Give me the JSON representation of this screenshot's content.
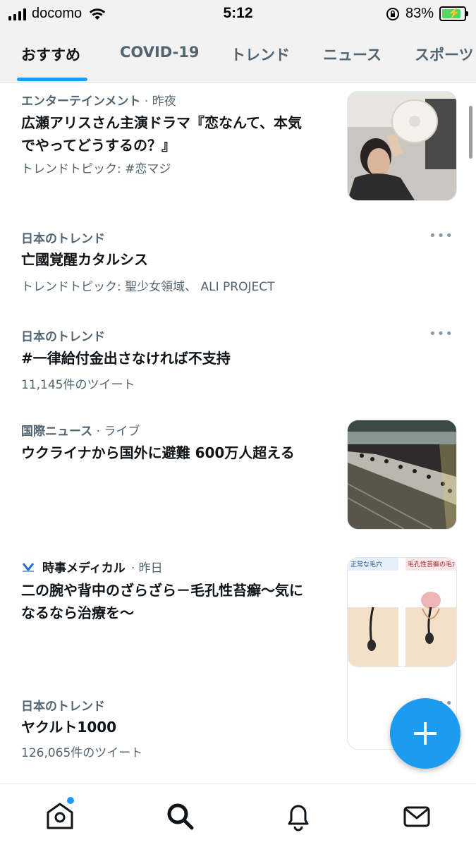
{
  "status_bar": {
    "carrier": "docomo",
    "time": "5:12",
    "battery_percent": "83%"
  },
  "tabs": [
    {
      "label": "おすすめ",
      "active": true
    },
    {
      "label": "COVID-19",
      "active": false
    },
    {
      "label": "トレンド",
      "active": false
    },
    {
      "label": "ニュース",
      "active": false
    },
    {
      "label": "スポーツ",
      "active": false
    }
  ],
  "feed": {
    "items": [
      {
        "category": "エンターテインメント",
        "time": "· 昨夜",
        "title_line1": "広瀬アリスさん主演ドラマ『恋なんて、本気",
        "title_line2": "でやってどうするの？』",
        "subtitle": "トレンドトピック: #恋マジ",
        "thumbnail": "drama-scene-photo"
      },
      {
        "category": "日本のトレンド",
        "title_line1": "亡國覚醒カタルシス",
        "subtitle": "トレンドトピック: 聖少女領域、 ALI PROJECT",
        "more": "•••"
      },
      {
        "category": "日本のトレンド",
        "title_line1": "#一律給付金出さなければ不支持",
        "subtitle": "11,145件のツイート",
        "more": "•••"
      },
      {
        "category": "国際ニュース",
        "time": "· ライブ",
        "title_line1": "ウクライナから国外に避難 600万人超える",
        "thumbnail": "train-station-crowd-photo"
      },
      {
        "source": "時事メディカル",
        "time": "· 昨日",
        "title_line1": "二の腕や背中のざらざら－毛孔性苔癬～気に",
        "title_line2": "なるなら治療を～",
        "thumbnail": "skin-pore-illustration",
        "thumb_label_left": "正常な毛穴",
        "thumb_label_right": "毛孔性苔癬の毛穴"
      },
      {
        "category": "日本のトレンド",
        "title_line1": "ヤクルト1000",
        "subtitle": "126,065件のツイート",
        "more": "•••"
      }
    ]
  },
  "bottom_nav": [
    {
      "icon": "home-icon",
      "has_badge": true
    },
    {
      "icon": "search-icon",
      "active": true
    },
    {
      "icon": "bell-icon"
    },
    {
      "icon": "mail-icon"
    }
  ],
  "fab_icon": "plus-icon",
  "colors": {
    "accent": "#1d9bf0",
    "text_primary": "#0f1419",
    "text_secondary": "#536471",
    "status_bar_bg": "#f2f2f2"
  }
}
